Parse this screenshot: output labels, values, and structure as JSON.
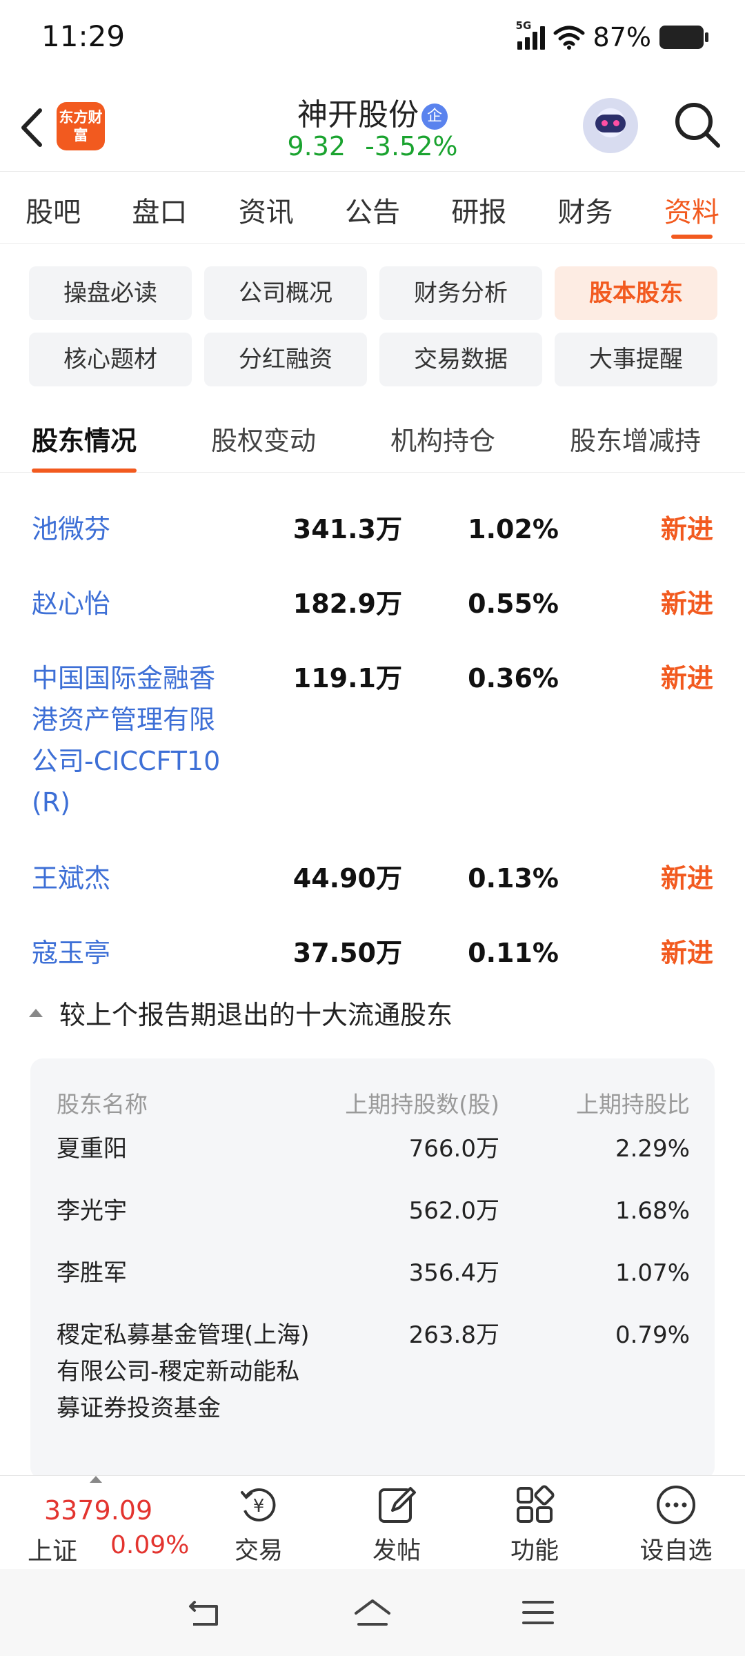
{
  "status": {
    "time": "11:29",
    "network": "5G",
    "battery": "87%"
  },
  "header": {
    "logo": "东方财富",
    "stock_name": "神开股份",
    "badge": "企",
    "price": "9.32",
    "change": "-3.52%"
  },
  "main_tabs": [
    "股吧",
    "盘口",
    "资讯",
    "公告",
    "研报",
    "财务",
    "资料"
  ],
  "chips": [
    "操盘必读",
    "公司概况",
    "财务分析",
    "股本股东",
    "核心题材",
    "分红融资",
    "交易数据",
    "大事提醒"
  ],
  "section_tabs": [
    "股东情况",
    "股权变动",
    "机构持仓",
    "股东增减持"
  ],
  "holders": [
    {
      "name": "池微芬",
      "shares": "341.3万",
      "ratio": "1.02%",
      "status": "新进"
    },
    {
      "name": "赵心怡",
      "shares": "182.9万",
      "ratio": "0.55%",
      "status": "新进"
    },
    {
      "name": "中国国际金融香港资产管理有限公司-CICCFT10(R)",
      "shares": "119.1万",
      "ratio": "0.36%",
      "status": "新进"
    },
    {
      "name": "王斌杰",
      "shares": "44.90万",
      "ratio": "0.13%",
      "status": "新进"
    },
    {
      "name": "寇玉亭",
      "shares": "37.50万",
      "ratio": "0.11%",
      "status": "新进"
    }
  ],
  "exited": {
    "title": "较上个报告期退出的十大流通股东",
    "headers": [
      "股东名称",
      "上期持股数(股)",
      "上期持股比"
    ],
    "rows": [
      {
        "name": "夏重阳",
        "shares": "766.0万",
        "ratio": "2.29%"
      },
      {
        "name": "李光宇",
        "shares": "562.0万",
        "ratio": "1.68%"
      },
      {
        "name": "李胜军",
        "shares": "356.4万",
        "ratio": "1.07%"
      },
      {
        "name": "稷定私募基金管理(上海)有限公司-稷定新动能私募证券投资基金",
        "shares": "263.8万",
        "ratio": "0.79%"
      }
    ]
  },
  "bottom_bar": {
    "index_value": "3379.09",
    "index_name": "上证",
    "index_change": "0.09%",
    "items": [
      "交易",
      "发帖",
      "功能",
      "设自选"
    ]
  },
  "colors": {
    "accent": "#f25a1f",
    "link": "#3d6fd6",
    "down": "#1aa32f",
    "up": "#e3342f"
  }
}
